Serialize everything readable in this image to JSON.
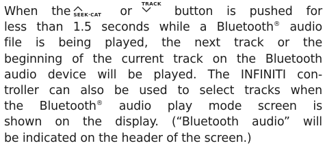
{
  "paragraph": {
    "l1_a": "When the",
    "seek_cat_label": "SEEK·CAT",
    "l1_b": "or",
    "track_label": "TRACK",
    "l1_c": "button is pushed for",
    "l2_a": "less than 1.5 seconds while a Bluetooth",
    "reg_mark": "®",
    "l2_b": " audio",
    "l3": "file is being played, the next track or the",
    "l4": "beginning of the current track on the Bluetooth",
    "l5": "audio device will be played. The INFINITI con-",
    "l6": "troller can also be used to select tracks when",
    "l7_a": "the Bluetooth",
    "l7_b": " audio play mode screen is",
    "l8": "shown on the display. (“Bluetooth audio” will",
    "l9": "be indicated on the header of the screen.)"
  },
  "icons": {
    "seek_cat": "seek-up-arrow-icon",
    "track": "track-down-arrow-icon"
  }
}
